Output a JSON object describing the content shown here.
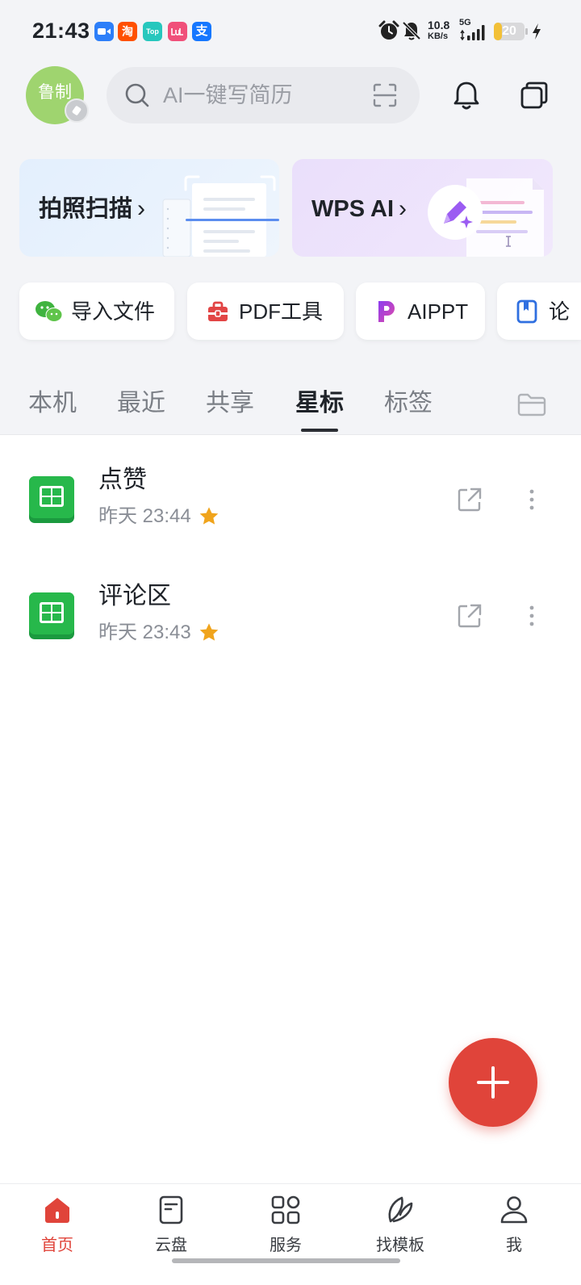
{
  "status_bar": {
    "time": "21:43",
    "app_icons": [
      {
        "name": "zoom-icon",
        "glyph": ""
      },
      {
        "name": "taobao-icon",
        "glyph": "淘"
      },
      {
        "name": "top-app-icon",
        "glyph": "Top"
      },
      {
        "name": "pink-app-icon",
        "glyph": ""
      },
      {
        "name": "alipay-icon",
        "glyph": "支"
      }
    ],
    "net_speed": "10.8",
    "net_speed_unit": "KB/s",
    "network_type": "5G",
    "battery_level": "20",
    "battery_fraction": 0.2,
    "charging": true
  },
  "header": {
    "avatar_text": "鲁制",
    "search_placeholder": "AI一键写简历",
    "icons": [
      "search-icon",
      "scan-icon",
      "bell-icon",
      "windows-icon"
    ]
  },
  "banners": [
    {
      "label": "拍照扫描",
      "arrow": "›",
      "icon": "scan-document-illustration"
    },
    {
      "label": "WPS AI",
      "arrow": "›",
      "icon": "ai-pen-illustration"
    }
  ],
  "quick_actions": [
    {
      "label": "导入文件",
      "icon": "wechat-icon"
    },
    {
      "label": "PDF工具",
      "icon": "pdf-toolbox-icon"
    },
    {
      "label": "AIPPT",
      "icon": "aippt-icon"
    },
    {
      "label": "论",
      "icon": "bookmark-icon"
    }
  ],
  "tabs": [
    {
      "label": "本机",
      "active": false
    },
    {
      "label": "最近",
      "active": false
    },
    {
      "label": "共享",
      "active": false
    },
    {
      "label": "星标",
      "active": true
    },
    {
      "label": "标签",
      "active": false
    }
  ],
  "files": [
    {
      "name": "点赞",
      "time": "昨天 23:44",
      "type": "spreadsheet",
      "starred": true
    },
    {
      "name": "评论区",
      "time": "昨天 23:43",
      "type": "spreadsheet",
      "starred": true
    }
  ],
  "fab": {
    "icon": "plus-icon"
  },
  "bottom_nav": [
    {
      "label": "首页",
      "icon": "home-icon",
      "active": true
    },
    {
      "label": "云盘",
      "icon": "cloud-drive-icon",
      "active": false
    },
    {
      "label": "服务",
      "icon": "services-icon",
      "active": false
    },
    {
      "label": "找模板",
      "icon": "template-icon",
      "active": false
    },
    {
      "label": "我",
      "icon": "profile-icon",
      "active": false
    }
  ],
  "colors": {
    "accent": "#e0443a",
    "star": "#f0a41c",
    "spreadsheet_green": "#27b84b",
    "page_bg": "#f3f4f7",
    "text_primary": "#1f2329",
    "text_secondary": "#8a8e96",
    "battery": "#f2c037"
  }
}
